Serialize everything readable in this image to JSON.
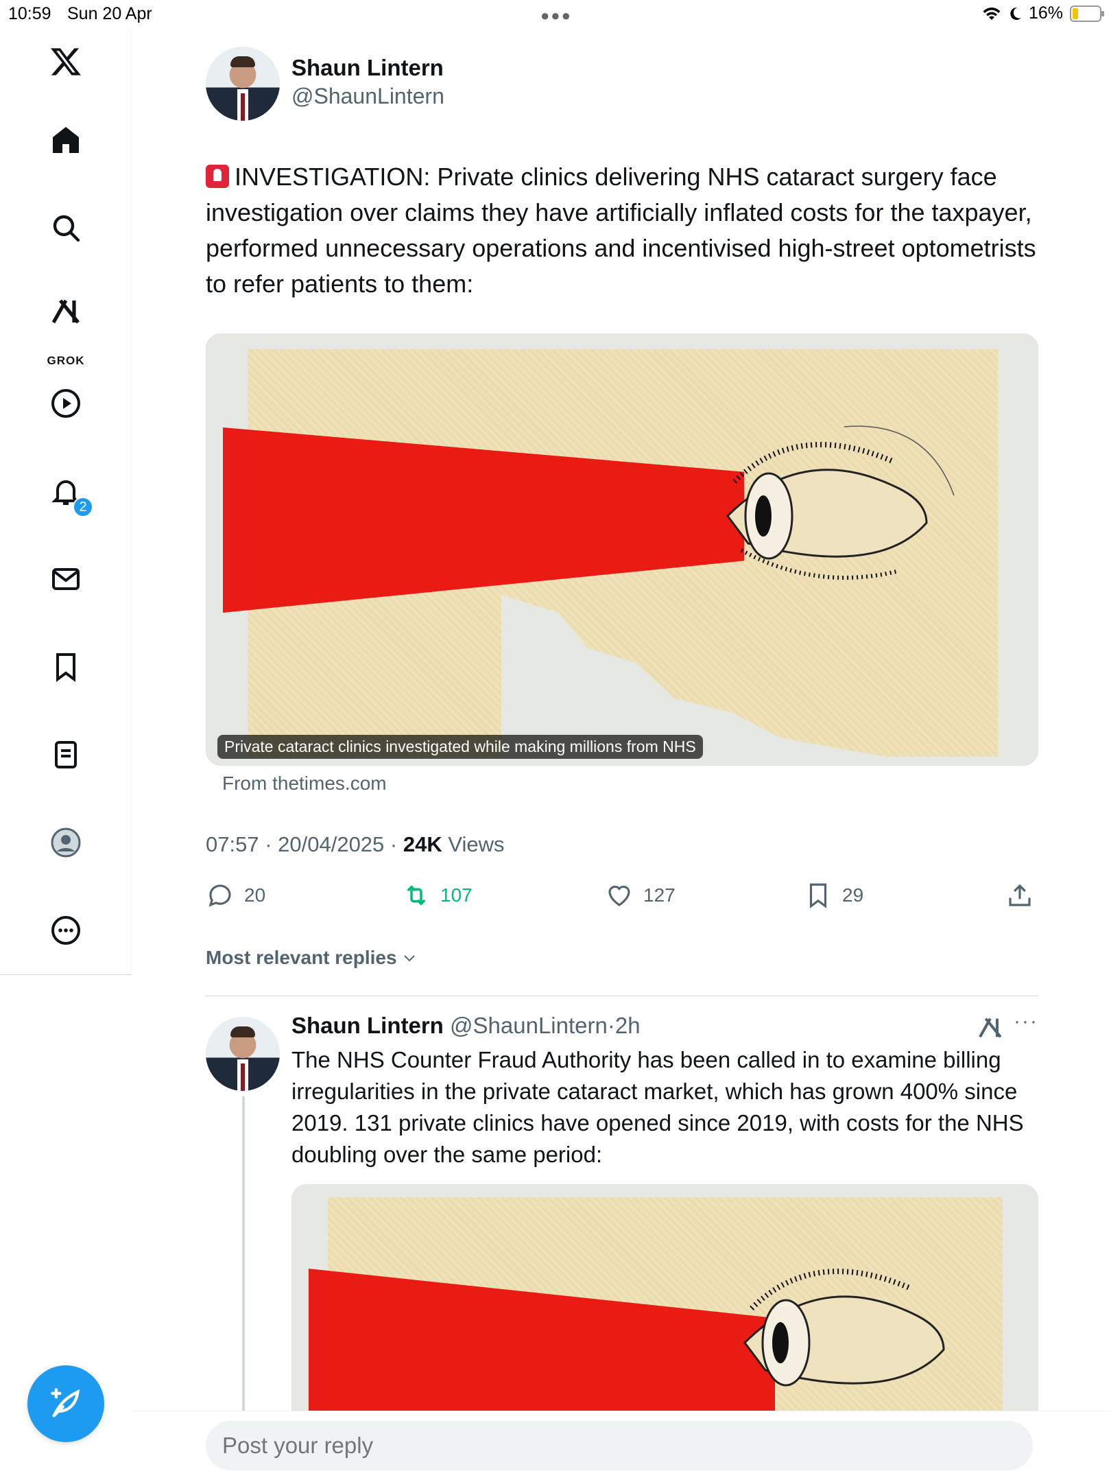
{
  "status_bar": {
    "time": "10:59",
    "date": "Sun 20 Apr",
    "battery": "16%"
  },
  "sidebar": {
    "grok_label": "GROK",
    "notifications_badge": "2"
  },
  "tweet": {
    "author_name": "Shaun Lintern",
    "author_handle": "@ShaunLintern",
    "text": "INVESTIGATION: Private clinics delivering NHS cataract surgery face investigation over claims they have artificially inflated costs for the taxpayer, performed unnecessary operations and incentivised high-street optometrists to refer patients to them:",
    "card_caption": "Private cataract clinics investigated while making millions from NHS",
    "card_source": "From thetimes.com",
    "time": "07:57",
    "date": "20/04/2025",
    "views_count": "24K",
    "views_label": "Views",
    "replies": "20",
    "retweets": "107",
    "likes": "127",
    "bookmarks": "29"
  },
  "replies_sort": "Most relevant replies",
  "reply": {
    "author_name": "Shaun Lintern",
    "author_handle": "@ShaunLintern",
    "age": "2h",
    "text": "The NHS Counter Fraud Authority has been called in to examine billing irregularities in the private cataract market, which has grown 400% since 2019. 131 private clinics have opened since 2019, with costs for the NHS doubling over the same period:"
  },
  "reply_box": {
    "placeholder": "Post your reply"
  },
  "colors": {
    "accent": "#1d9bf0",
    "retweet_green": "#00ba7c",
    "text": "#0f1419",
    "muted": "#536471"
  }
}
